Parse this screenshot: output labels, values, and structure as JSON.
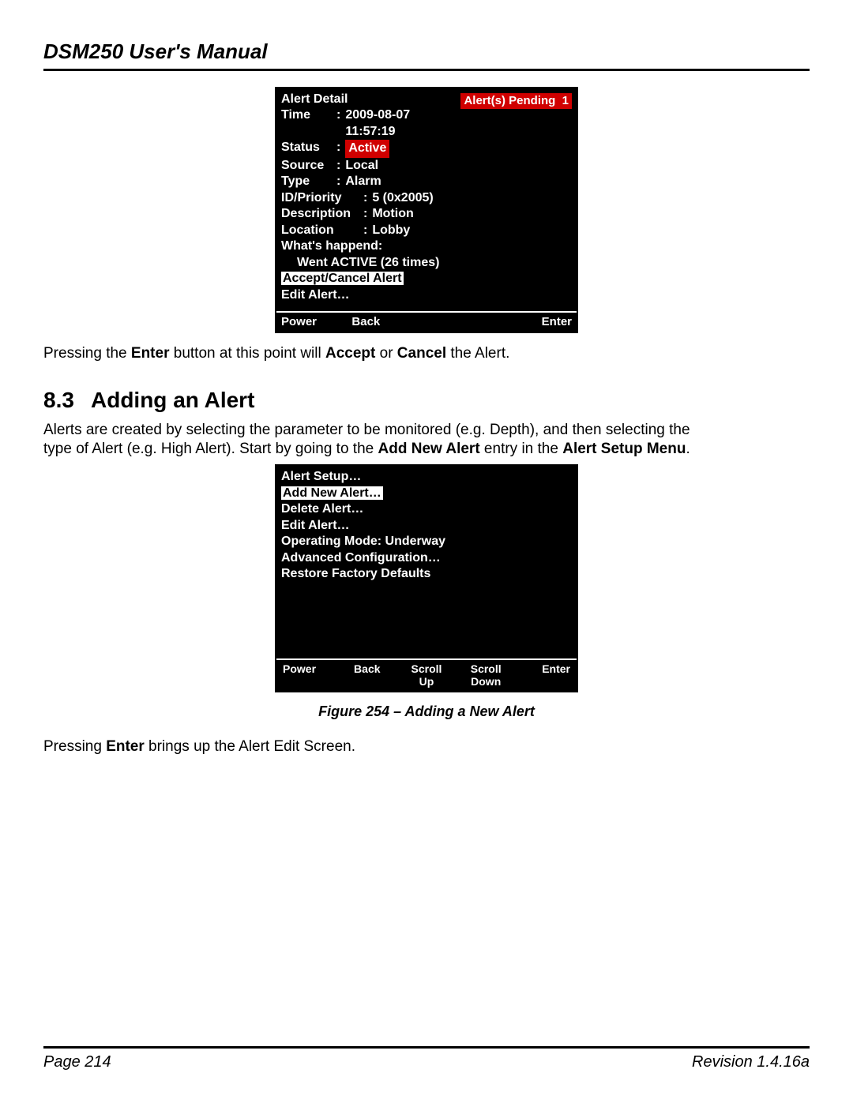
{
  "header": {
    "title": "DSM250 User's Manual"
  },
  "screen1": {
    "title": "Alert Detail",
    "pending_label": "Alert(s) Pending",
    "pending_count": "1",
    "fields": {
      "time_label": "Time",
      "time_value": "2009-08-07 11:57:19",
      "status_label": "Status",
      "status_value": "Active",
      "source_label": "Source",
      "source_value": "Local",
      "type_label": "Type",
      "type_value": "Alarm",
      "idprio_label": "ID/Priority",
      "idprio_value": "5 (0x2005)",
      "desc_label": "Description",
      "desc_value": "Motion",
      "loc_label": "Location",
      "loc_value": "Lobby",
      "what_label": "What's happend:",
      "what_value": "Went ACTIVE (26 times)"
    },
    "actions": {
      "accept": "Accept/Cancel Alert",
      "edit": "Edit Alert…"
    },
    "buttons": {
      "power": "Power",
      "back": "Back",
      "enter": "Enter"
    }
  },
  "para1": {
    "pre": "Pressing the ",
    "b1": "Enter",
    "mid": " button at this point will ",
    "b2": "Accept",
    "or": " or ",
    "b3": "Cancel",
    "post": " the Alert."
  },
  "section": {
    "num": "8.3",
    "title": "Adding an Alert"
  },
  "para2": {
    "line1": "Alerts are created by selecting the parameter to be monitored (e.g. Depth), and then selecting the",
    "line2_pre": "type of Alert (e.g. High Alert). Start by going to the ",
    "b1": "Add New Alert",
    "mid": " entry in the ",
    "b2": "Alert Setup Menu",
    "post": "."
  },
  "screen2": {
    "items": [
      "Alert Setup…",
      "Add New Alert…",
      "Delete Alert…",
      "Edit Alert…",
      "Operating Mode:  Underway",
      "Advanced Configuration…",
      "Restore Factory Defaults"
    ],
    "selected_index": 1,
    "buttons": {
      "power": "Power",
      "back": "Back",
      "scrollup": "Scroll\nUp",
      "scrolldown": "Scroll\nDown",
      "enter": "Enter"
    }
  },
  "caption2": "Figure 254 – Adding a New Alert",
  "para3": {
    "pre": "Pressing ",
    "b1": "Enter",
    "post": " brings up the Alert Edit Screen."
  },
  "footer": {
    "page": "Page 214",
    "rev": "Revision 1.4.16a"
  }
}
